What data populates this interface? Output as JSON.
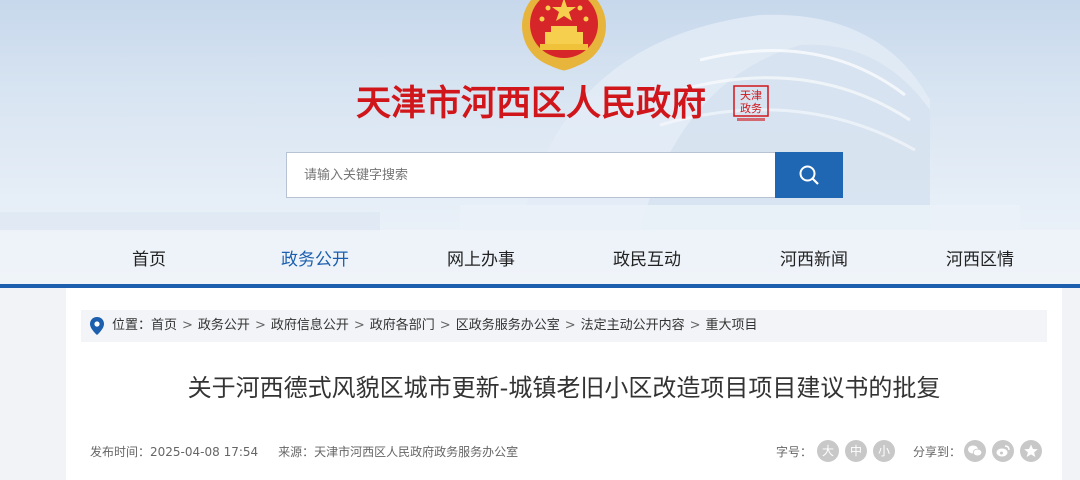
{
  "header": {
    "site_title": "天津市河西区人民政府",
    "seal_text": "天津 政务",
    "search": {
      "placeholder": "请输入关键字搜索"
    }
  },
  "nav": {
    "items": [
      {
        "label": "首页"
      },
      {
        "label": "政务公开",
        "active": true
      },
      {
        "label": "网上办事"
      },
      {
        "label": "政民互动"
      },
      {
        "label": "河西新闻"
      },
      {
        "label": "河西区情"
      }
    ]
  },
  "breadcrumb": {
    "label": "位置：",
    "items": [
      "首页",
      "政务公开",
      "政府信息公开",
      "政府各部门",
      "区政务服务办公室",
      "法定主动公开内容",
      "重大项目"
    ],
    "separator": ">"
  },
  "article": {
    "title": "关于河西德式风貌区城市更新-城镇老旧小区改造项目项目建议书的批复",
    "publish_label": "发布时间：",
    "publish_time": "2025-04-08 17:54",
    "source_label": "来源：",
    "source": "天津市河西区人民政府政务服务办公室",
    "font_size_label": "字号：",
    "font_sizes": [
      "大",
      "中",
      "小"
    ],
    "share_label": "分享到："
  },
  "colors": {
    "brand_red": "#d0161b",
    "nav_blue": "#1b5fae",
    "search_button": "#1f66b3",
    "icon_gray": "#c8c8c8"
  },
  "icons": [
    "national-emblem-icon",
    "search-icon",
    "location-pin-icon",
    "wechat-icon",
    "weibo-icon",
    "favorite-icon"
  ]
}
